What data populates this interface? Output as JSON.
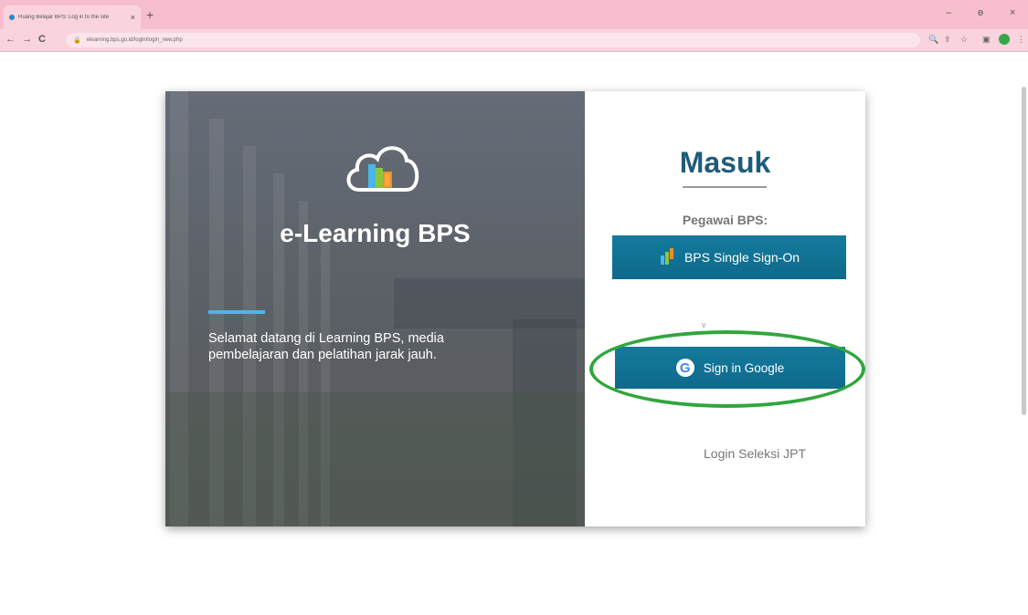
{
  "browser": {
    "tab_title": "Ruang Belajar BPS: Log in to the site",
    "url": "elearning.bps.go.id/login/login_new.php",
    "new_tab": "+",
    "close_tab": "×",
    "back": "←",
    "forward": "→",
    "reload": "C",
    "minimize": "–",
    "maximize": "ɵ",
    "close_window": "×"
  },
  "hero": {
    "title": "e-Learning BPS",
    "welcome_text": "Selamat datang di Learning BPS, media pembelajaran dan pelatihan jarak jauh."
  },
  "login": {
    "heading": "Masuk",
    "employee_label": "Pegawai BPS:",
    "sso_button": "BPS Single Sign-On",
    "divider_mark": "v",
    "google_button": "Sign in Google",
    "jpt_link": "Login Seleksi JPT"
  },
  "colors": {
    "tabbar": "#f7bfcd",
    "button": "#0e6a8c",
    "heading": "#1f5b7a",
    "accent_line": "#4ab7e8",
    "highlight": "#30a63d"
  },
  "icons": {
    "logo": "cloud-logo-icon",
    "sso": "bps-logo-icon",
    "google": "google-icon"
  }
}
